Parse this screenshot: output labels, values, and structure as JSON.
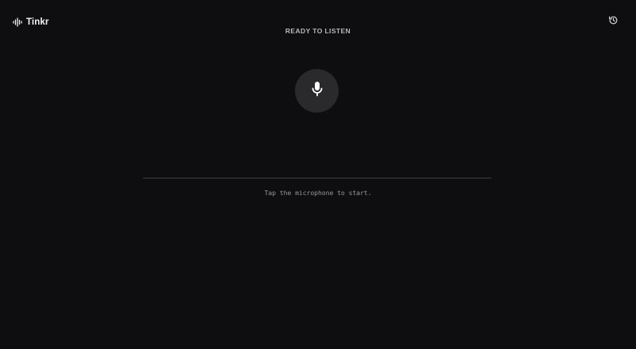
{
  "header": {
    "app_name": "Tinkr",
    "logo_icon": "waveform-icon",
    "history_icon": "history-icon"
  },
  "status": {
    "text": "READY TO LISTEN"
  },
  "mic": {
    "icon": "microphone-icon"
  },
  "transcript": {
    "placeholder": "Tap the microphone to start."
  },
  "colors": {
    "background": "#0e0d0f",
    "mic_button": "#2a292c",
    "divider": "#3e3d41",
    "text_primary": "#f2f2f2",
    "text_muted": "#9a9a9a"
  }
}
